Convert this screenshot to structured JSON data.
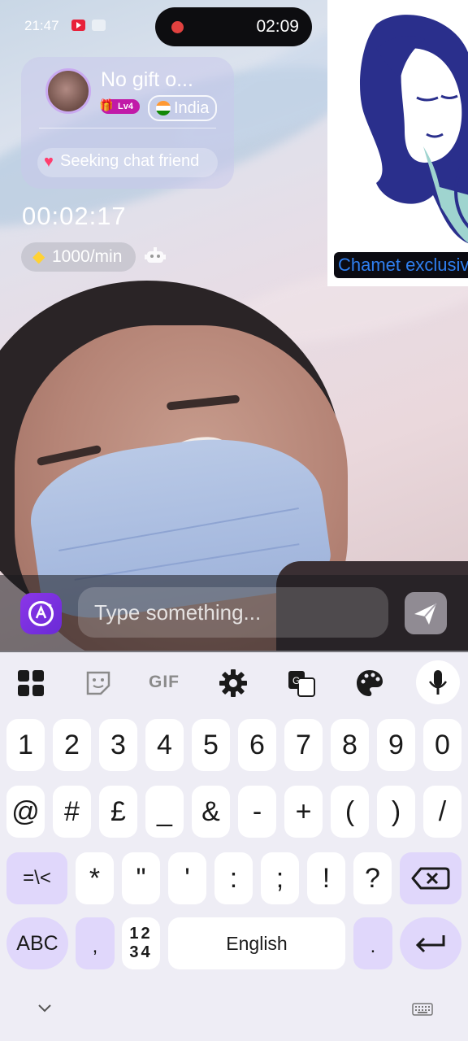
{
  "status_bar": {
    "time": "21:47"
  },
  "recording": {
    "elapsed": "02:09"
  },
  "profile": {
    "name": "No gift o...",
    "level": "Lv4",
    "country": "India",
    "tagline": "Seeking chat friend"
  },
  "call": {
    "timer": "00:02:17",
    "rate": "1000/min"
  },
  "promo": {
    "label": "Chamet exclusive"
  },
  "composer": {
    "placeholder": "Type something..."
  },
  "keyboard": {
    "toolbar": {
      "gif": "GIF"
    },
    "number_row": [
      "1",
      "2",
      "3",
      "4",
      "5",
      "6",
      "7",
      "8",
      "9",
      "0"
    ],
    "symbol_row": [
      "@",
      "#",
      "£",
      "_",
      "&",
      "-",
      "+",
      "(",
      ")",
      "/"
    ],
    "row3": [
      "*",
      "\"",
      "'",
      ":",
      ";",
      "!",
      "?"
    ],
    "mode_key": "=\\<",
    "abc_key": "ABC",
    "comma_key": ",",
    "numpad_top": "12",
    "numpad_bottom": "34",
    "space_label": "English",
    "period_key": "."
  },
  "colors": {
    "accent": "#e0d7fb",
    "brand_purple": "#7b31e0",
    "promo_blue": "#2f7ff0",
    "record_red": "#e0413f"
  }
}
